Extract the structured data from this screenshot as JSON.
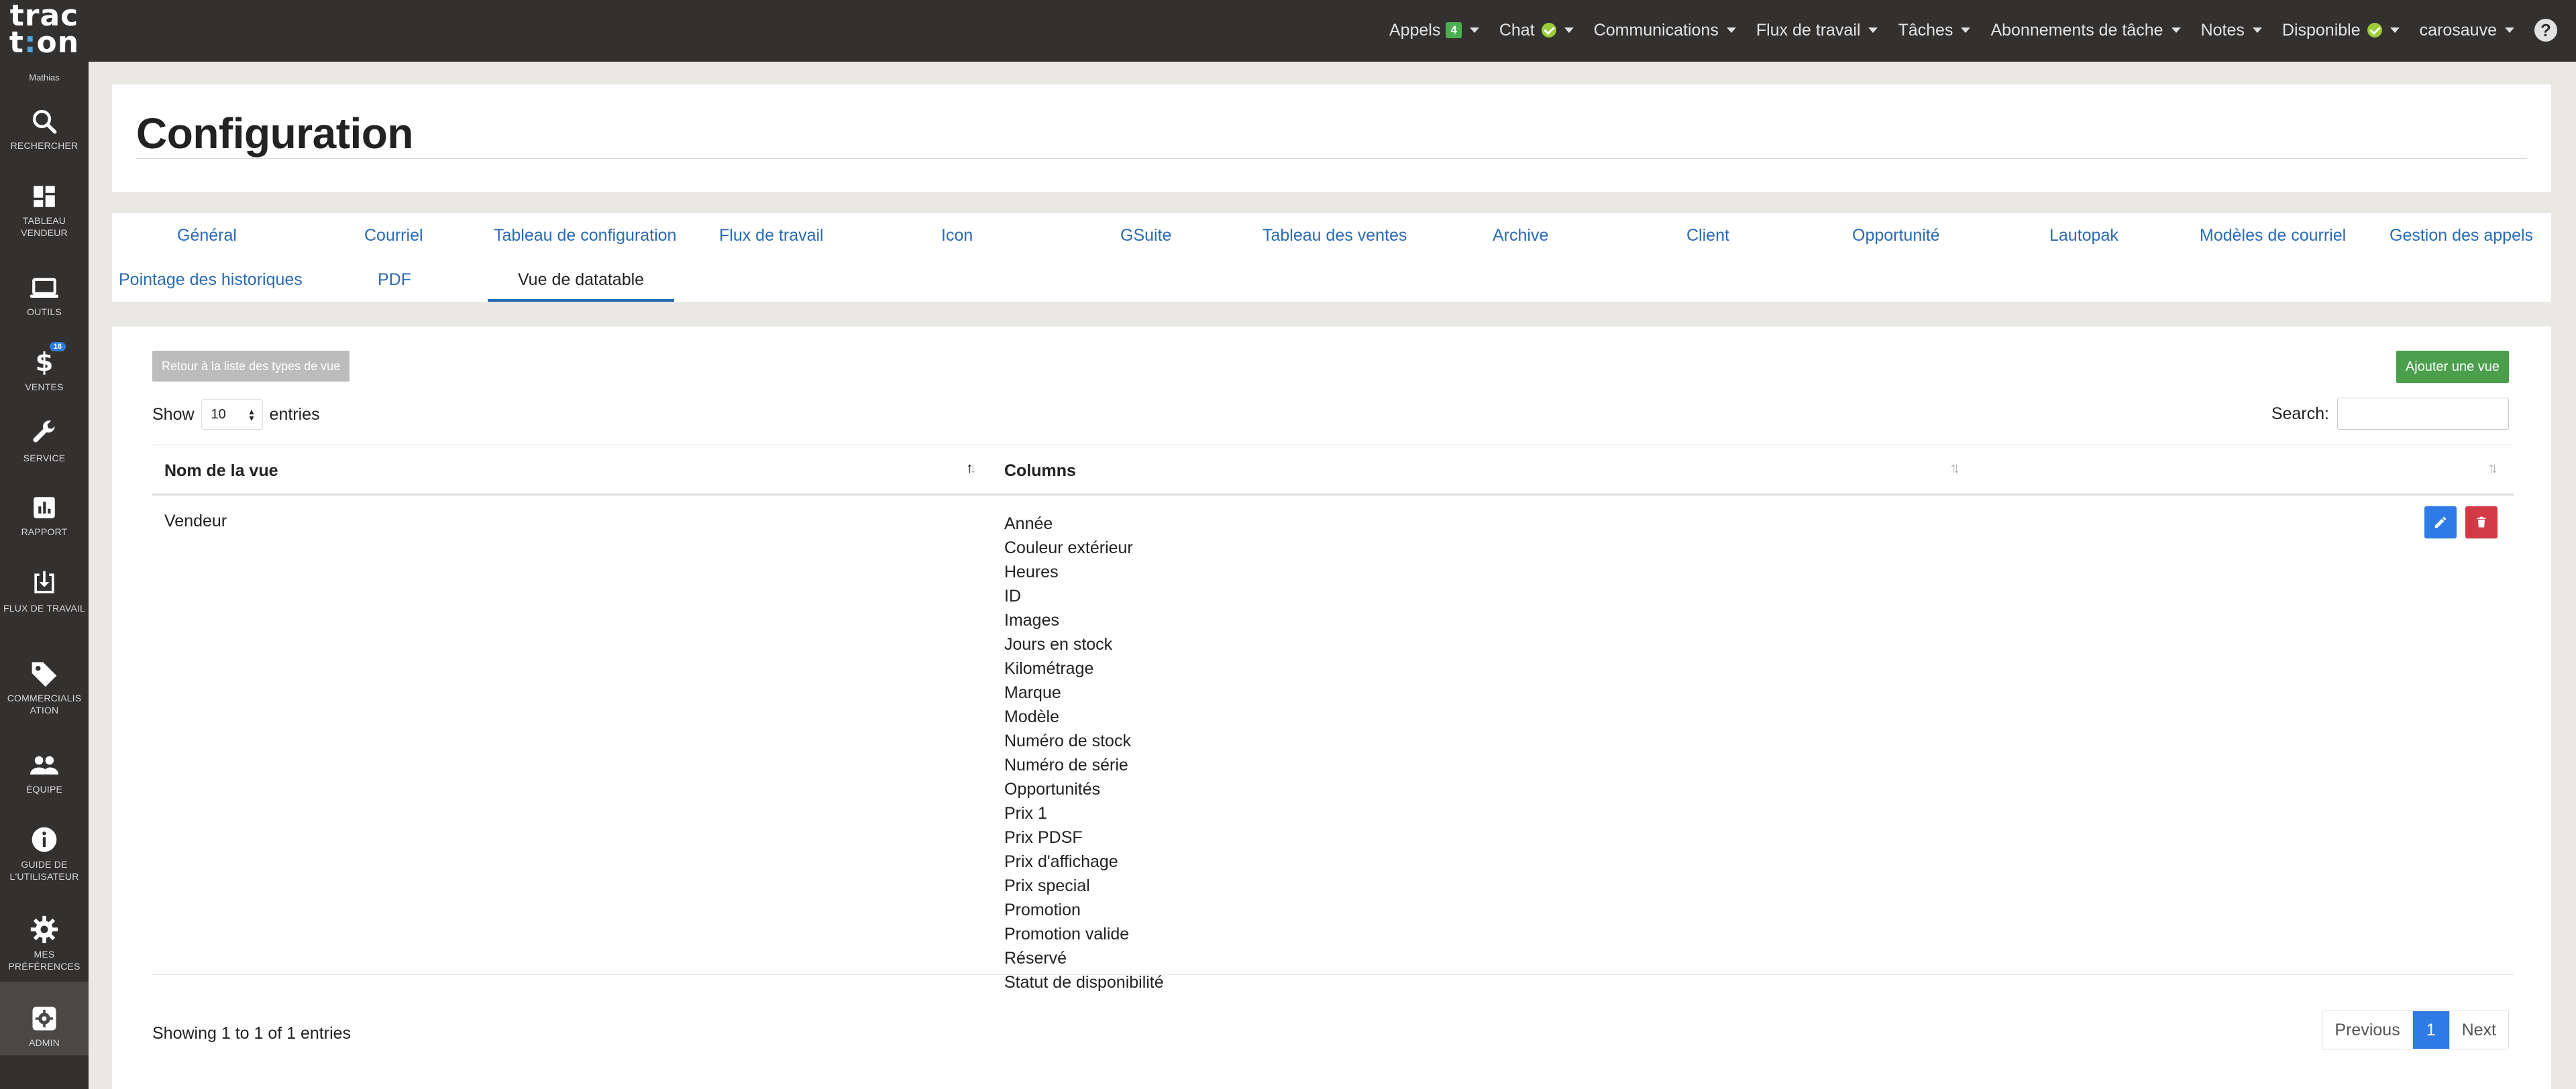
{
  "app": {
    "logo_line1": "trac",
    "logo_line2_a": "t",
    "logo_line2_colon": ":",
    "logo_line2_b": "on",
    "user_name": "Mathias"
  },
  "sidebar": {
    "items": [
      {
        "label": "RECHERCHER",
        "icon": "search-icon"
      },
      {
        "label": "TABLEAU VENDEUR",
        "icon": "dashboard-icon"
      },
      {
        "label": "OUTILS",
        "icon": "laptop-icon"
      },
      {
        "label": "VENTES",
        "icon": "dollar-icon",
        "badge": "16"
      },
      {
        "label": "SERVICE",
        "icon": "wrench-icon"
      },
      {
        "label": "RAPPORT",
        "icon": "bar-chart-icon"
      },
      {
        "label": "FLUX DE TRAVAIL",
        "icon": "download-box-icon"
      },
      {
        "label": "COMMERCIALIS ATION",
        "icon": "tag-icon"
      },
      {
        "label": "ÉQUIPE",
        "icon": "people-icon"
      },
      {
        "label": "GUIDE DE L'UTILISATEUR",
        "icon": "info-icon"
      },
      {
        "label": "MES PRÉFÉRENCES",
        "icon": "gear-icon"
      },
      {
        "label": "ADMIN",
        "icon": "admin-gear-icon",
        "active": true
      }
    ]
  },
  "topnav": {
    "appels": "Appels",
    "appels_badge": "4",
    "chat": "Chat",
    "communications": "Communications",
    "flux": "Flux de travail",
    "taches": "Tâches",
    "abonnements": "Abonnements de tâche",
    "notes": "Notes",
    "disponible": "Disponible",
    "user": "carosauve",
    "help": "?"
  },
  "page": {
    "title": "Configuration"
  },
  "tabs": [
    {
      "label": "Général"
    },
    {
      "label": "Courriel"
    },
    {
      "label": "Tableau de configuration"
    },
    {
      "label": "Flux de travail"
    },
    {
      "label": "Icon"
    },
    {
      "label": "GSuite"
    },
    {
      "label": "Tableau des ventes"
    },
    {
      "label": "Archive"
    },
    {
      "label": "Client"
    },
    {
      "label": "Opportunité"
    },
    {
      "label": "Lautopak"
    },
    {
      "label": "Modèles de courriel"
    },
    {
      "label": "Gestion des appels"
    },
    {
      "label": "Pointage des historiques"
    },
    {
      "label": "PDF"
    },
    {
      "label": "Vue de datatable",
      "active": true
    }
  ],
  "main": {
    "back_button": "Retour à la liste des types de vue",
    "add_button": "Ajouter une vue",
    "show_label": "Show",
    "entries_value": "10",
    "entries_label": "entries",
    "search_label": "Search:",
    "search_value": "",
    "table": {
      "headers": [
        "Nom de la vue",
        "Columns",
        ""
      ],
      "rows": [
        {
          "name": "Vendeur",
          "columns": [
            "Année",
            "Couleur extérieur",
            "Heures",
            "ID",
            "Images",
            "Jours en stock",
            "Kilométrage",
            "Marque",
            "Modèle",
            "Numéro de stock",
            "Numéro de série",
            "Opportunités",
            "Prix 1",
            "Prix PDSF",
            "Prix d'affichage",
            "Prix special",
            "Promotion",
            "Promotion valide",
            "Réservé",
            "Statut de disponibilité"
          ]
        }
      ]
    },
    "info": "Showing 1 to 1 of 1 entries",
    "pagination": {
      "previous": "Previous",
      "current": "1",
      "next": "Next"
    }
  },
  "colors": {
    "sidebar_bg": "#333130",
    "link": "#2a6bb3",
    "primary": "#2f7be6",
    "success": "#4a9e4c",
    "danger": "#d23a45"
  }
}
